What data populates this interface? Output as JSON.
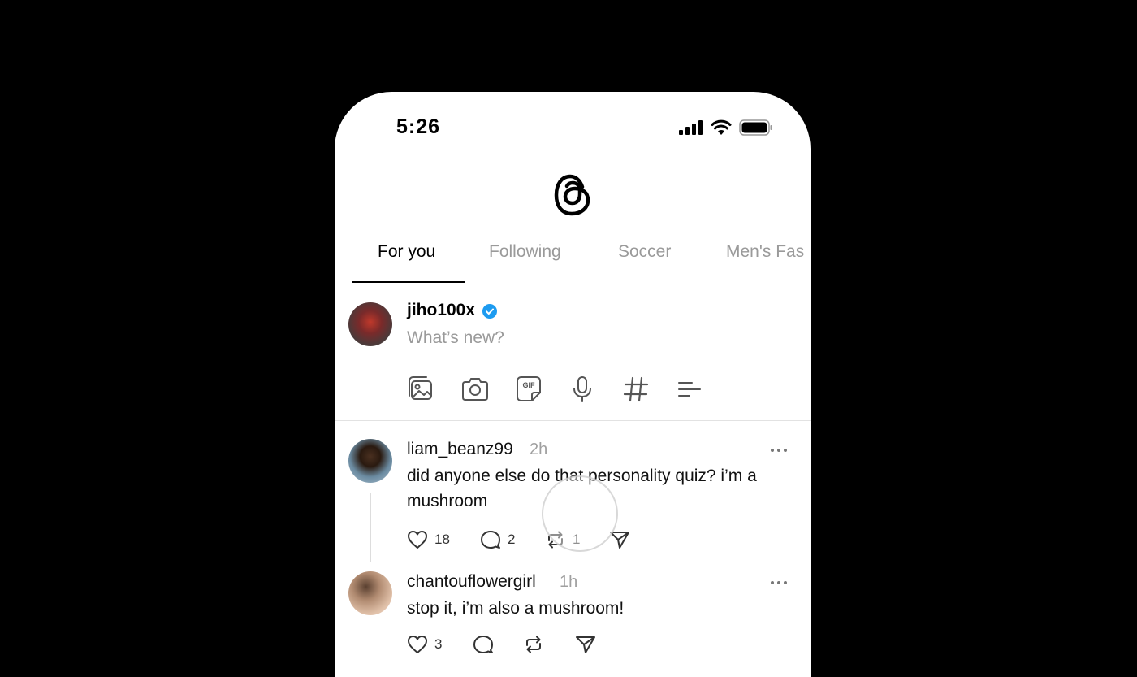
{
  "status": {
    "time": "5:26"
  },
  "tabs": [
    {
      "label": "For you",
      "active": true
    },
    {
      "label": "Following",
      "active": false
    },
    {
      "label": "Soccer",
      "active": false
    },
    {
      "label": "Men's Fas",
      "active": false
    }
  ],
  "composer": {
    "username": "jiho100x",
    "verified": true,
    "placeholder": "What’s new?",
    "tools": [
      "gallery-icon",
      "camera-icon",
      "gif-icon",
      "microphone-icon",
      "hashtag-icon",
      "poll-icon"
    ]
  },
  "posts": [
    {
      "username": "liam_beanz99",
      "time": "2h",
      "text": "did anyone else do that personality quiz? i’m a mushroom",
      "likes": "18",
      "replies": "2",
      "reposts": "1"
    },
    {
      "username": "chantouflowergirl",
      "time": "1h",
      "text": "stop it, i’m also a mushroom!",
      "likes": "3",
      "replies": "",
      "reposts": ""
    }
  ],
  "colors": {
    "verified": "#1d9bf0",
    "muted": "#9a9a9a",
    "divider": "#dddddd"
  }
}
